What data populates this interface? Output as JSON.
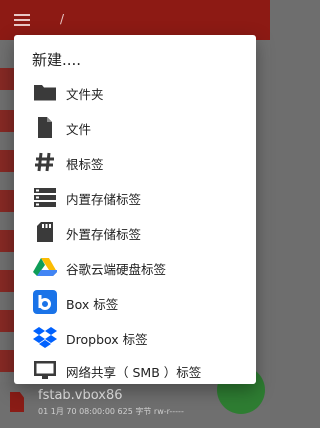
{
  "appbar": {
    "path": "/"
  },
  "bottom_file": {
    "name": "fstab.vbox86",
    "meta": "01 1月 70 08:00:00  625 字节  rw-r-----"
  },
  "dialog": {
    "title": "新建....",
    "items": [
      {
        "label": "文件夹",
        "icon": "folder-icon"
      },
      {
        "label": "文件",
        "icon": "file-icon"
      },
      {
        "label": "根标签",
        "icon": "hash-icon"
      },
      {
        "label": "内置存储标签",
        "icon": "storage-icon"
      },
      {
        "label": "外置存储标签",
        "icon": "sd-card-icon"
      },
      {
        "label": "谷歌云端硬盘标签",
        "icon": "google-drive-icon"
      },
      {
        "label": "Box 标签",
        "icon": "box-icon"
      },
      {
        "label": "Dropbox 标签",
        "icon": "dropbox-icon"
      },
      {
        "label": "网络共享（ SMB ）标签",
        "icon": "monitor-icon"
      }
    ]
  },
  "colors": {
    "appbar": "#8d1a14",
    "fab": "#2e7d32",
    "dialog_bg": "#ffffff",
    "icon_dark": "#3a3a3a"
  }
}
